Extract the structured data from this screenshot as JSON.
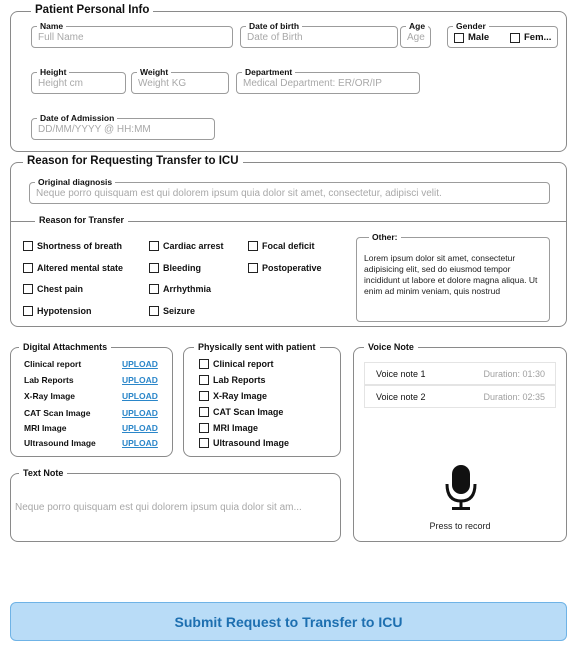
{
  "personal": {
    "title": "Patient Personal Info",
    "name_label": "Name",
    "name_placeholder": "Full Name",
    "dob_label": "Date of birth",
    "dob_placeholder": "Date of Birth",
    "age_label": "Age",
    "age_placeholder": "Age",
    "gender_label": "Gender",
    "gender_male": "Male",
    "gender_female": "Fem...",
    "height_label": "Height",
    "height_placeholder": "Height cm",
    "weight_label": "Weight",
    "weight_placeholder": "Weight KG",
    "department_label": "Department",
    "department_placeholder": "Medical Department: ER/OR/IP",
    "admission_label": "Date of Admission",
    "admission_placeholder": "DD/MM/YYYY @ HH:MM"
  },
  "transfer": {
    "title": "Reason for Requesting Transfer to ICU",
    "diagnosis_label": "Original diagnosis",
    "diagnosis_placeholder": "Neque porro quisquam est qui dolorem ipsum quia dolor sit amet, consectetur, adipisci velit.",
    "reason_label": "Reason for Transfer",
    "reasons": [
      "Shortness of breath",
      "Cardiac arrest",
      "Focal deficit",
      "Altered mental state",
      "Bleeding",
      "Postoperative",
      "Chest pain",
      "Arrhythmia",
      "Hypotension",
      "Seizure"
    ],
    "other_label": "Other:",
    "other_text": "Lorem ipsum dolor sit amet, consectetur adipisicing elit, sed do eiusmod tempor incididunt ut labore et dolore magna aliqua. Ut enim ad minim veniam, quis nostrud"
  },
  "attachments": {
    "title": "Digital Attachments",
    "items": [
      "Clinical report",
      "Lab Reports",
      "X-Ray Image",
      "CAT Scan Image",
      "MRI Image",
      "Ultrasound Image"
    ],
    "upload_label": "UPLOAD"
  },
  "physical": {
    "title": "Physically sent with patient",
    "items": [
      "Clinical report",
      "Lab Reports",
      "X-Ray Image",
      "CAT Scan Image",
      "MRI Image",
      "Ultrasound Image"
    ]
  },
  "voice": {
    "title": "Voice Note",
    "notes": [
      {
        "name": "Voice note 1",
        "duration": "Duration: 01:30"
      },
      {
        "name": "Voice note 2",
        "duration": "Duration: 02:35"
      }
    ],
    "record_label": "Press to record",
    "mic_icon": "microphone-icon"
  },
  "text_note": {
    "title": "Text Note",
    "placeholder": "Neque porro quisquam est qui dolorem ipsum quia dolor sit am..."
  },
  "submit_label": "Submit Request to Transfer to ICU",
  "colors": {
    "accent": "#2a86c9",
    "submit_bg": "#b9dcf7",
    "submit_text": "#1d6fb0",
    "border": "#8a8a8a",
    "placeholder": "#a8a8a8"
  }
}
